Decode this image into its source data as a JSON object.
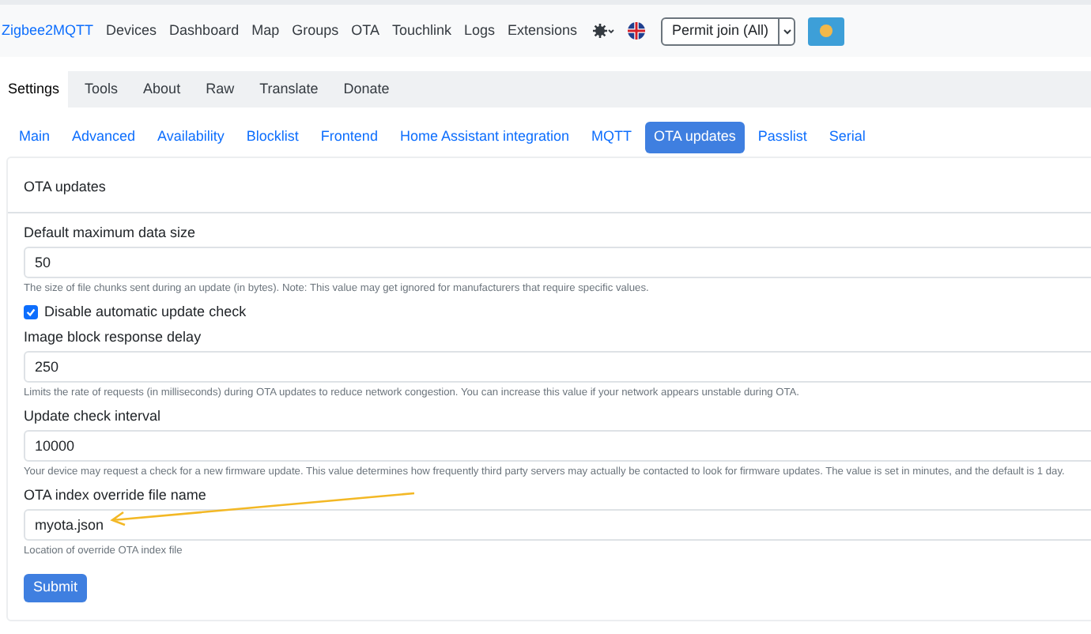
{
  "navbar": {
    "brand": "Zigbee2MQTT",
    "links": [
      "Devices",
      "Dashboard",
      "Map",
      "Groups",
      "OTA",
      "Touchlink",
      "Logs",
      "Extensions"
    ],
    "permit_join": "Permit join (All)"
  },
  "tabs": [
    {
      "label": "Settings",
      "selected": true
    },
    {
      "label": "Tools",
      "selected": false
    },
    {
      "label": "About",
      "selected": false
    },
    {
      "label": "Raw",
      "selected": false
    },
    {
      "label": "Translate",
      "selected": false
    },
    {
      "label": "Donate",
      "selected": false
    }
  ],
  "subtabs": [
    {
      "label": "Main",
      "selected": false
    },
    {
      "label": "Advanced",
      "selected": false
    },
    {
      "label": "Availability",
      "selected": false
    },
    {
      "label": "Blocklist",
      "selected": false
    },
    {
      "label": "Frontend",
      "selected": false
    },
    {
      "label": "Home Assistant integration",
      "selected": false
    },
    {
      "label": "MQTT",
      "selected": false
    },
    {
      "label": "OTA updates",
      "selected": true
    },
    {
      "label": "Passlist",
      "selected": false
    },
    {
      "label": "Serial",
      "selected": false
    }
  ],
  "card": {
    "title": "OTA updates",
    "fields": [
      {
        "kind": "input",
        "label": "Default maximum data size",
        "value": "50",
        "help": "The size of file chunks sent during an update (in bytes). Note: This value may get ignored for manufacturers that require specific values."
      },
      {
        "kind": "checkbox",
        "label": "Disable automatic update check",
        "checked": true
      },
      {
        "kind": "input",
        "label": "Image block response delay",
        "value": "250",
        "help": "Limits the rate of requests (in milliseconds) during OTA updates to reduce network congestion. You can increase this value if your network appears unstable during OTA."
      },
      {
        "kind": "input",
        "label": "Update check interval",
        "value": "10000",
        "help": "Your device may request a check for a new firmware update. This value determines how frequently third party servers may actually be contacted to look for firmware updates. The value is set in minutes, and the default is 1 day."
      },
      {
        "kind": "input",
        "label": "OTA index override file name",
        "value": "myota.json",
        "help": "Location of override OTA index file"
      }
    ],
    "submit": "Submit"
  }
}
